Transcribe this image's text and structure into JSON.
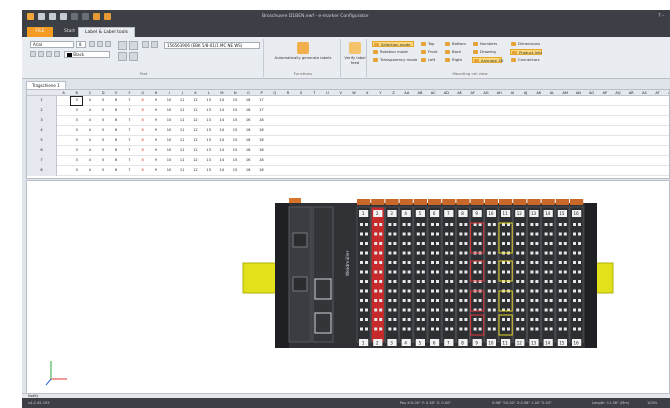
{
  "window": {
    "title": "Broschuere D1BEN.ewf - e-marker Configurator",
    "help": "?  -"
  },
  "tabs": {
    "file": "FILE",
    "start": "Start",
    "active": "Label & Label tools"
  },
  "ribbon": {
    "font_name": "Arial",
    "font_size": "8",
    "font_color": "Black",
    "field_value": "156563906 (EBK 5/8-01/1 MC NE WS)",
    "group_text": "Text",
    "automatic_label": "Automatically generate labels",
    "functions": "Functions",
    "verify_label": "Verify label feed",
    "mv_items": [
      "Selection mode",
      "Rotation mode",
      "Transparency mode",
      "Top",
      "Front",
      "Left",
      "Bottom",
      "Back",
      "Right",
      "Numbers",
      "Drawing",
      "Animate 3D",
      "Dimensions",
      "Product info",
      "Connectors"
    ],
    "mv_label": "Mounting rail view",
    "colors": {
      "accent": "#f39b22",
      "highlight": "#fbd97c"
    }
  },
  "doc_tab": "Tragschiene 1",
  "grid": {
    "columns": [
      "A",
      "B",
      "C",
      "D",
      "E",
      "F",
      "G",
      "H",
      "I",
      "J",
      "K",
      "L",
      "M",
      "N",
      "O",
      "P",
      "Q",
      "R",
      "S",
      "T",
      "U",
      "V",
      "W",
      "X",
      "Y",
      "Z",
      "AA",
      "AB",
      "AC",
      "AD",
      "AE",
      "AF",
      "AG",
      "AH",
      "AI",
      "AJ",
      "AK",
      "AL",
      "AM",
      "AN",
      "AO",
      "AP",
      "AQ",
      "AR",
      "AS",
      "AT",
      "AU",
      "AV",
      "AW"
    ],
    "row_numbers": [
      "1",
      "2",
      "3",
      "4",
      "5",
      "6",
      "7",
      "8"
    ],
    "rows": [
      [
        "3",
        "4",
        "5",
        "6",
        "7",
        "8",
        "9",
        "10",
        "11",
        "12",
        "13",
        "14",
        "15",
        "16",
        "17"
      ],
      [
        "3",
        "4",
        "5",
        "6",
        "7",
        "8",
        "9",
        "10",
        "11",
        "12",
        "13",
        "14",
        "15",
        "16",
        "17"
      ],
      [
        "3",
        "4",
        "5",
        "6",
        "7",
        "8",
        "9",
        "10",
        "11",
        "12",
        "13",
        "14",
        "15",
        "16",
        "18"
      ],
      [
        "3",
        "4",
        "5",
        "6",
        "7",
        "8",
        "9",
        "10",
        "11",
        "12",
        "13",
        "14",
        "15",
        "16",
        "18"
      ],
      [
        "3",
        "4",
        "5",
        "6",
        "7",
        "8",
        "9",
        "10",
        "11",
        "12",
        "13",
        "14",
        "15",
        "16",
        "18"
      ],
      [
        "3",
        "4",
        "5",
        "6",
        "7",
        "8",
        "9",
        "10",
        "11",
        "12",
        "13",
        "14",
        "15",
        "16",
        "18"
      ],
      [
        "3",
        "4",
        "5",
        "6",
        "7",
        "8",
        "9",
        "10",
        "11",
        "12",
        "13",
        "14",
        "15",
        "16",
        "18"
      ],
      [
        "3",
        "4",
        "5",
        "6",
        "7",
        "8",
        "9",
        "10",
        "11",
        "12",
        "13",
        "14",
        "15",
        "16",
        "18"
      ]
    ]
  },
  "view": {
    "top_labels": [
      "1",
      "2",
      "3",
      "4",
      "5",
      "6",
      "7",
      "8",
      "9",
      "10",
      "11",
      "12",
      "13",
      "14",
      "15",
      "16"
    ],
    "bottom_labels": [
      "1",
      "2",
      "3",
      "4",
      "5",
      "6",
      "7",
      "8",
      "9",
      "10",
      "11",
      "12",
      "13",
      "14",
      "15",
      "16"
    ],
    "brand": "Weidmüller"
  },
  "notify": "Notify",
  "status": {
    "left": "v4.0.45.193",
    "pos": "Pos X:0.00\" Y: 0.38\" Z: 0.00\"",
    "dim": "X:98\" Y:0.00\" Z:0.98\" 1.00 \"2.03\"",
    "length": "Length: 11.36\" (Mm)",
    "zoom": "100%"
  }
}
